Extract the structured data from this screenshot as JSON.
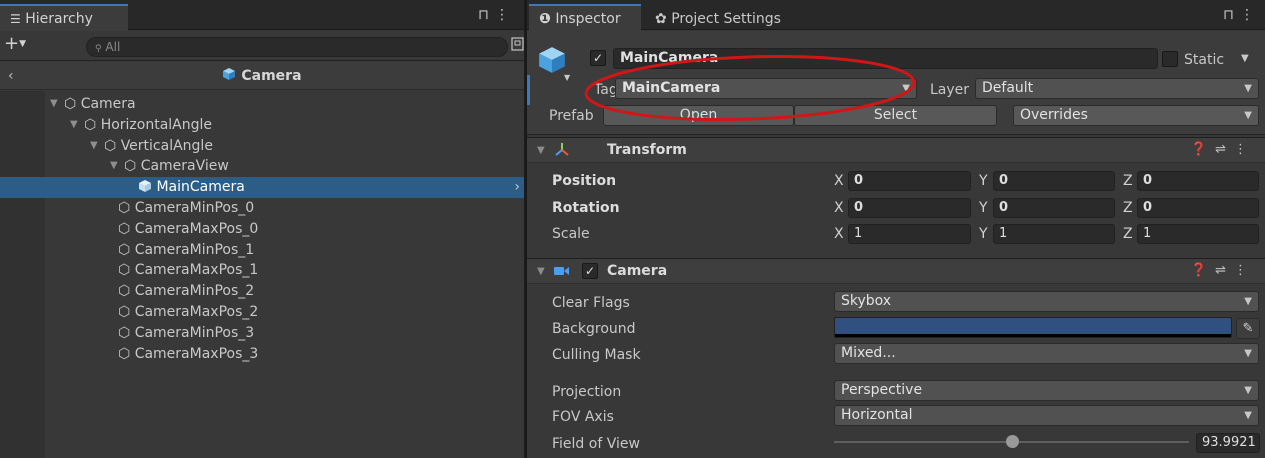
{
  "hierarchy": {
    "tab_label": "Hierarchy",
    "search_placeholder": "All",
    "scene_title": "Camera",
    "items": [
      {
        "label": "Camera"
      },
      {
        "label": "HorizontalAngle"
      },
      {
        "label": "VerticalAngle"
      },
      {
        "label": "CameraView"
      },
      {
        "label": "MainCamera"
      },
      {
        "label": "CameraMinPos_0"
      },
      {
        "label": "CameraMaxPos_0"
      },
      {
        "label": "CameraMinPos_1"
      },
      {
        "label": "CameraMaxPos_1"
      },
      {
        "label": "CameraMinPos_2"
      },
      {
        "label": "CameraMaxPos_2"
      },
      {
        "label": "CameraMinPos_3"
      },
      {
        "label": "CameraMaxPos_3"
      }
    ]
  },
  "inspector": {
    "tabs": [
      {
        "label": "Inspector"
      },
      {
        "label": "Project Settings"
      }
    ],
    "object_name": "MainCamera",
    "static_label": "Static",
    "tag_label": "Tag",
    "tag_value": "MainCamera",
    "layer_label": "Layer",
    "layer_value": "Default",
    "prefab_label": "Prefab",
    "prefab_buttons": {
      "open": "Open",
      "select": "Select",
      "overrides": "Overrides"
    },
    "transform": {
      "title": "Transform",
      "rows": [
        {
          "label": "Position",
          "x": "0",
          "y": "0",
          "z": "0"
        },
        {
          "label": "Rotation",
          "x": "0",
          "y": "0",
          "z": "0"
        },
        {
          "label": "Scale",
          "x": "1",
          "y": "1",
          "z": "1"
        }
      ],
      "axis_labels": {
        "x": "X",
        "y": "Y",
        "z": "Z"
      }
    },
    "camera": {
      "title": "Camera",
      "clear_flags_label": "Clear Flags",
      "clear_flags_value": "Skybox",
      "background_label": "Background",
      "background_color": "#30507f",
      "culling_mask_label": "Culling Mask",
      "culling_mask_value": "Mixed...",
      "projection_label": "Projection",
      "projection_value": "Perspective",
      "fov_axis_label": "FOV Axis",
      "fov_axis_value": "Horizontal",
      "fov_label": "Field of View",
      "fov_value": "93.9921",
      "fov_slider_fraction": 0.5
    }
  },
  "annotation": {
    "color": "#d01616"
  },
  "colors": {
    "selection": "#2c5d87",
    "accent": "#3a79bb"
  }
}
